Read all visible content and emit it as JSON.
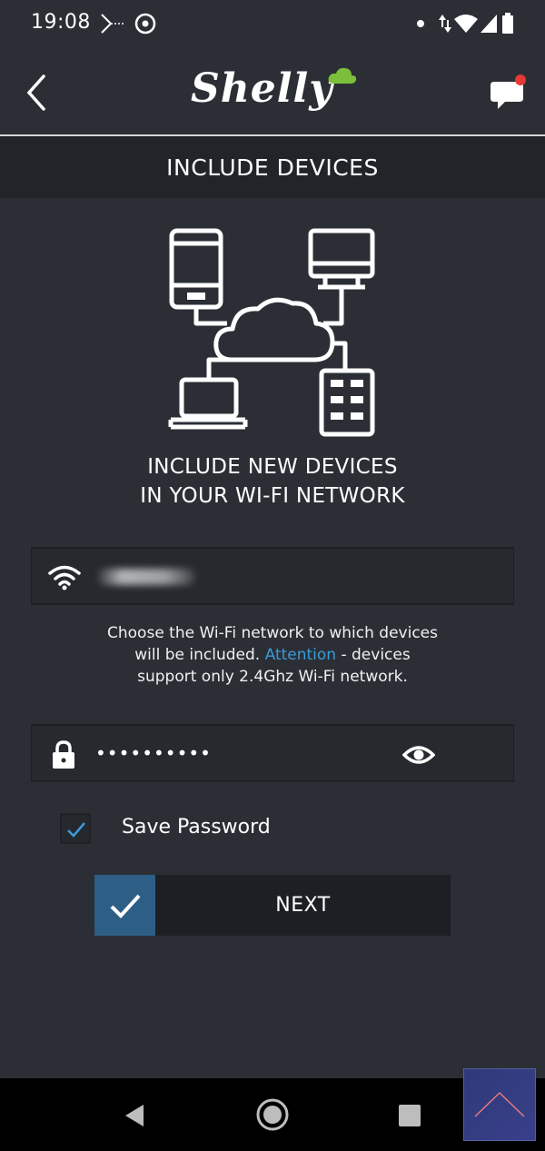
{
  "status_bar": {
    "time": "19:08"
  },
  "header": {
    "logo_text": "Shelly",
    "has_notification": true
  },
  "title_bar": {
    "title": "INCLUDE DEVICES"
  },
  "headline": {
    "line1": "INCLUDE NEW DEVICES",
    "line2": "IN YOUR WI-FI NETWORK"
  },
  "wifi_field": {
    "icon": "wifi-icon"
  },
  "hint": {
    "line1": "Choose the Wi-Fi network to which devices",
    "line2_before": "will be included.",
    "attention": "Attention",
    "line2_after": " - devices",
    "line3": "support only 2.4Ghz Wi-Fi network."
  },
  "password_field": {
    "value": "••••••••••"
  },
  "save_password": {
    "label": "Save Password",
    "checked": true
  },
  "next_button": {
    "label": "NEXT"
  },
  "colors": {
    "background": "#2b2f35",
    "title_bar": "#212428",
    "accent_link": "#3a9bd9",
    "next_check": "#2d5e86",
    "notification_dot": "#e53935"
  }
}
